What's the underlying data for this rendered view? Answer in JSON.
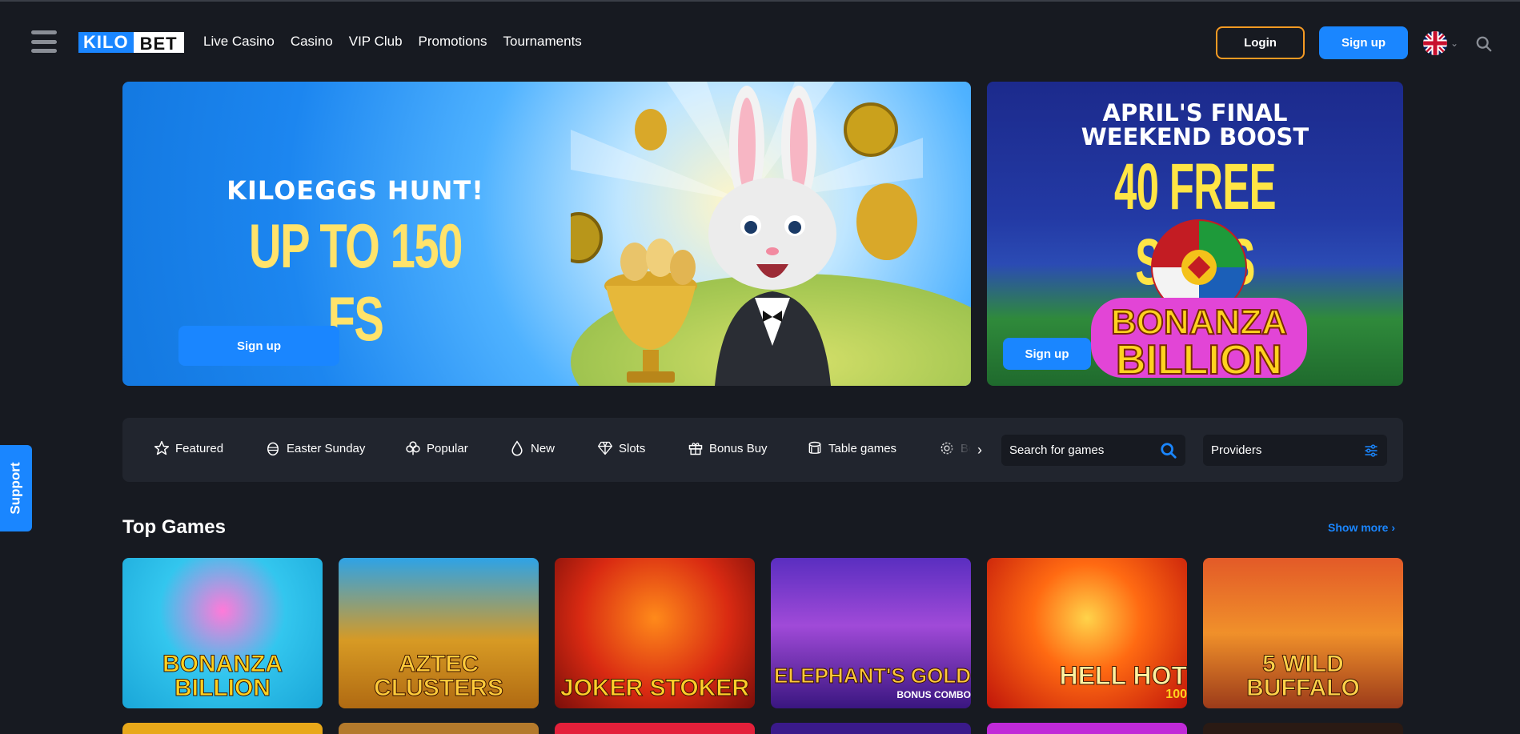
{
  "header": {
    "logo_part1": "KILO",
    "logo_part2": "BET",
    "nav": [
      "Live Casino",
      "Casino",
      "VIP Club",
      "Promotions",
      "Tournaments"
    ],
    "login_label": "Login",
    "signup_label": "Sign up",
    "language": "en-GB flag"
  },
  "banners": {
    "main": {
      "title": "KILOEGGS HUNT!",
      "subtitle": "UP TO 150 FS",
      "cta": "Sign up"
    },
    "side": {
      "title_line1": "APRIL'S FINAL",
      "title_line2": "WEEKEND BOOST",
      "subtitle": "40 FREE SPINS",
      "cta": "Sign up"
    }
  },
  "categories": [
    {
      "label": "Featured",
      "icon": "star-icon"
    },
    {
      "label": "Easter Sunday",
      "icon": "egg-icon"
    },
    {
      "label": "Popular",
      "icon": "clover-icon"
    },
    {
      "label": "New",
      "icon": "drop-icon"
    },
    {
      "label": "Slots",
      "icon": "diamond-icon"
    },
    {
      "label": "Bonus Buy",
      "icon": "gift-icon"
    },
    {
      "label": "Table games",
      "icon": "cards-icon"
    },
    {
      "label": "Bo",
      "icon": "gear-icon"
    }
  ],
  "search": {
    "placeholder": "Search for games"
  },
  "providers": {
    "label": "Providers"
  },
  "top_games": {
    "title": "Top Games",
    "show_more": "Show more",
    "games": [
      "BONANZA BILLION",
      "AZTEC CLUSTERS",
      "JOKER STOKER",
      "ELEPHANT'S GOLD",
      "HELL HOT",
      "5 WILD BUFFALO"
    ],
    "game_sublabels": [
      "",
      "",
      "",
      "BONUS COMBO",
      "100",
      ""
    ]
  },
  "support": {
    "label": "Support"
  },
  "colors": {
    "accent": "#1a86ff",
    "login_border": "#f59a23",
    "background": "#171a21",
    "panel": "#21252e"
  }
}
